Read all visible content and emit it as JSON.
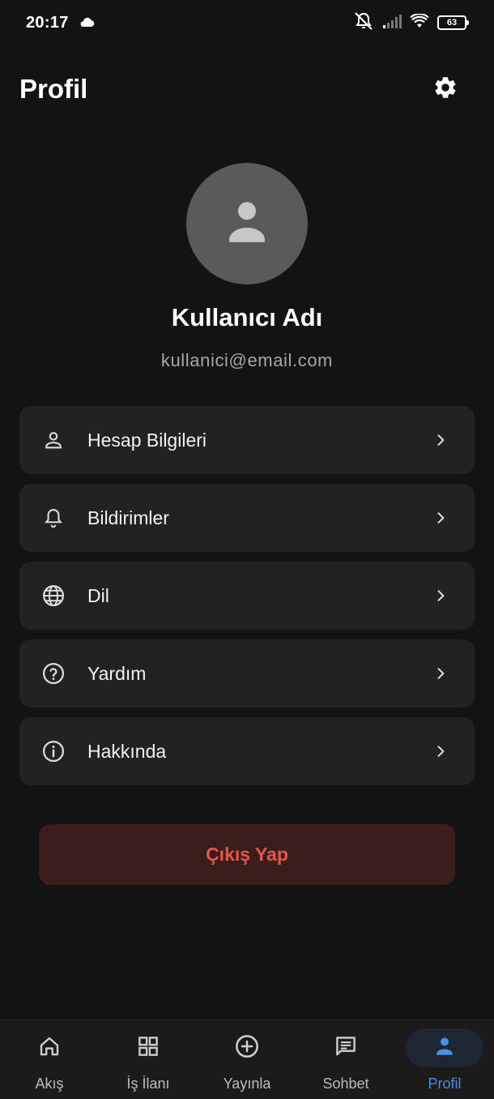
{
  "status_bar": {
    "time": "20:17",
    "battery": "63",
    "icons": [
      "cloud-icon",
      "bell-off-icon",
      "signal-icon",
      "wifi-icon",
      "battery-icon"
    ]
  },
  "header": {
    "title": "Profil",
    "settings_icon": "gear-icon"
  },
  "profile": {
    "name": "Kullanıcı Adı",
    "email": "kullanici@email.com",
    "avatar_icon": "person-icon"
  },
  "menu": {
    "items": [
      {
        "label": "Hesap Bilgileri",
        "icon": "person-outline-icon"
      },
      {
        "label": "Bildirimler",
        "icon": "bell-icon"
      },
      {
        "label": "Dil",
        "icon": "globe-icon"
      },
      {
        "label": "Yardım",
        "icon": "help-circle-icon"
      },
      {
        "label": "Hakkında",
        "icon": "info-circle-icon"
      }
    ]
  },
  "logout": {
    "label": "Çıkış Yap"
  },
  "bottom_nav": {
    "items": [
      {
        "label": "Akış",
        "icon": "home-icon"
      },
      {
        "label": "İş İlanı",
        "icon": "grid-icon"
      },
      {
        "label": "Yayınla",
        "icon": "add-circle-icon"
      },
      {
        "label": "Sohbet",
        "icon": "chat-icon"
      },
      {
        "label": "Profil",
        "icon": "person-icon"
      }
    ],
    "active_index": 4
  },
  "colors": {
    "background": "#131313",
    "card": "#222222",
    "accent": "#4a90e2",
    "danger_text": "#e2584a",
    "danger_bg": "#3b1d1b"
  }
}
